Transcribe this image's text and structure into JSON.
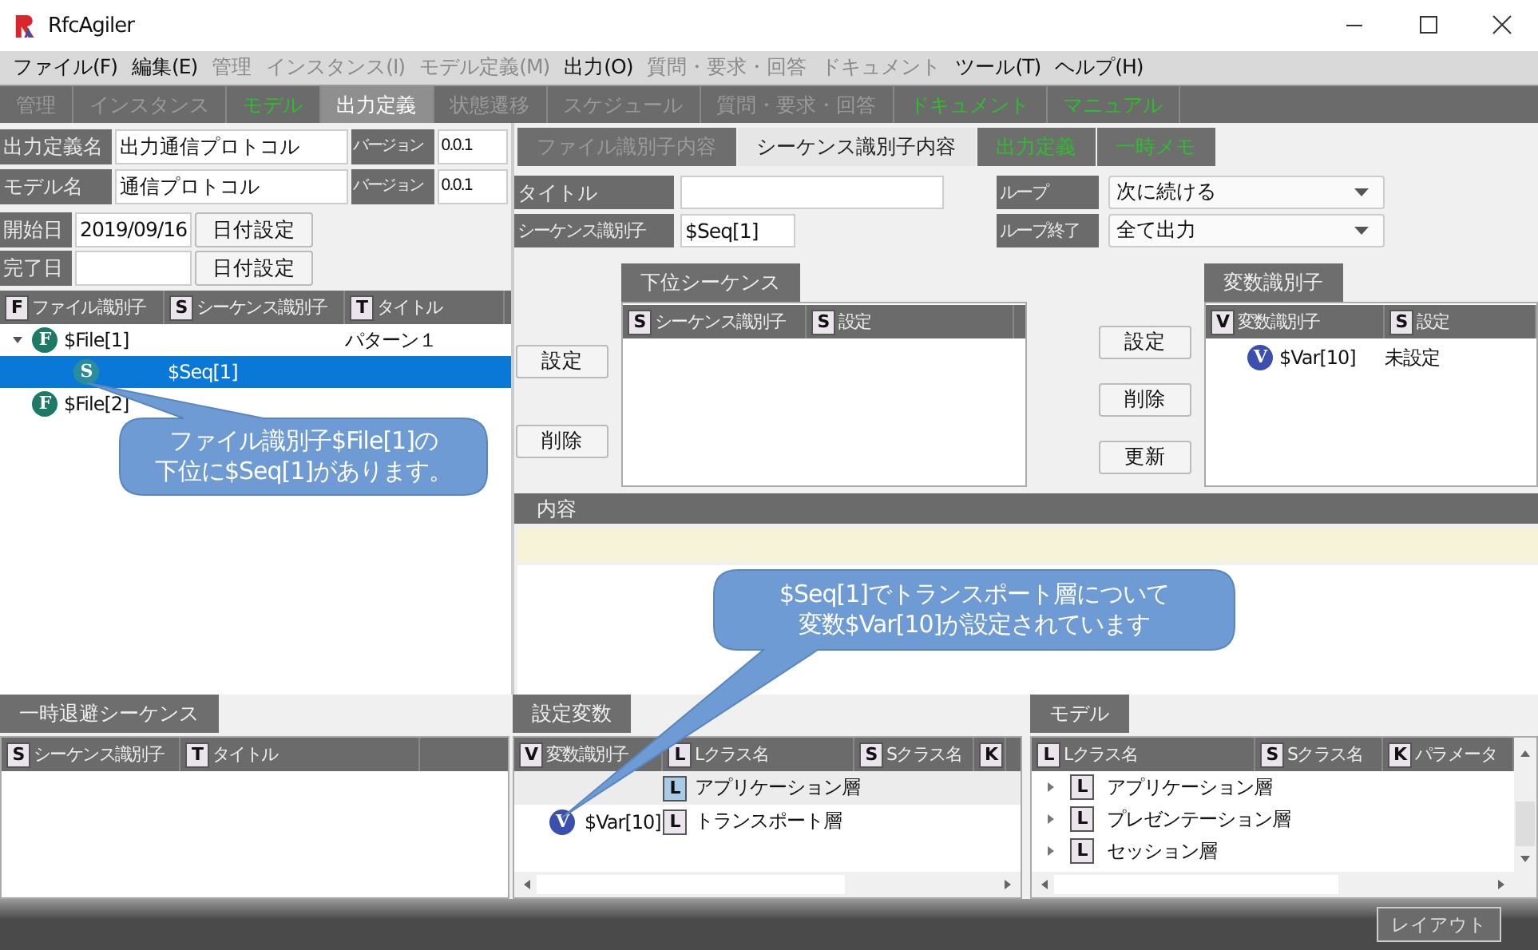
{
  "window": {
    "title": "RfcAgiler"
  },
  "menu": [
    {
      "label": "ファイル(F)",
      "disabled": false
    },
    {
      "label": "編集(E)",
      "disabled": false
    },
    {
      "label": "管理",
      "disabled": true
    },
    {
      "label": "インスタンス(I)",
      "disabled": true
    },
    {
      "label": "モデル定義(M)",
      "disabled": true
    },
    {
      "label": "出力(O)",
      "disabled": false
    },
    {
      "label": "質問・要求・回答",
      "disabled": true
    },
    {
      "label": "ドキュメント",
      "disabled": true
    },
    {
      "label": "ツール(T)",
      "disabled": false
    },
    {
      "label": "ヘルプ(H)",
      "disabled": false
    }
  ],
  "main_tabs": [
    {
      "label": "管理",
      "kind": "dimmed",
      "selected": false
    },
    {
      "label": "インスタンス",
      "kind": "dimmed",
      "selected": false
    },
    {
      "label": "モデル",
      "kind": "green",
      "selected": false
    },
    {
      "label": "出力定義",
      "kind": "plain",
      "selected": true
    },
    {
      "label": "状態遷移",
      "kind": "dimmed",
      "selected": false
    },
    {
      "label": "スケジュール",
      "kind": "dimmed",
      "selected": false
    },
    {
      "label": "質問・要求・回答",
      "kind": "dimmed",
      "selected": false
    },
    {
      "label": "ドキュメント",
      "kind": "green",
      "selected": false
    },
    {
      "label": "マニュアル",
      "kind": "green",
      "selected": false
    }
  ],
  "definition": [
    {
      "label": "出力定義名",
      "value": "出力通信プロトコル",
      "version_label": "バージョン",
      "version": "0.0.1"
    },
    {
      "label": "モデル名",
      "value": "通信プロトコル",
      "version_label": "バージョン",
      "version": "0.0.1"
    }
  ],
  "dates": [
    {
      "label": "開始日",
      "value": "2019/09/16",
      "button": "日付設定"
    },
    {
      "label": "完了日",
      "button": "日付設定"
    }
  ],
  "tree": {
    "columns": [
      {
        "badge": "F",
        "label": "ファイル識別子"
      },
      {
        "badge": "S",
        "label": "シーケンス識別子"
      },
      {
        "badge": "T",
        "label": "タイトル"
      }
    ],
    "rows": [
      {
        "badge": "F",
        "color": "#1e7a66",
        "identifier": "$File[1]",
        "title": "パターン１",
        "expanded": true,
        "selected": false,
        "children": [
          {
            "badge": "S",
            "color": "#2b8c9c",
            "identifier": "$Seq[1]",
            "selected": true
          }
        ]
      },
      {
        "badge": "F",
        "color": "#1e7a66",
        "identifier": "$File[2]",
        "selected": false
      }
    ]
  },
  "sub_tabs": [
    {
      "label": "ファイル識別子内容",
      "kind": "dimmed",
      "selected": false
    },
    {
      "label": "シーケンス識別子内容",
      "kind": "plain",
      "selected": true
    },
    {
      "label": "出力定義",
      "kind": "green",
      "selected": false
    },
    {
      "label": "一時メモ",
      "kind": "green",
      "selected": false
    }
  ],
  "form": {
    "title": {
      "label": "タイトル"
    },
    "sequence_id": {
      "label": "シーケンス識別子",
      "value": "$Seq[1]"
    },
    "loop": {
      "label": "ループ",
      "value": "次に続ける"
    },
    "loop_end": {
      "label": "ループ終了",
      "value": "全て出力"
    }
  },
  "side_buttons": [
    "設定",
    "削除"
  ],
  "sub_sequence": {
    "tab": "下位シーケンス",
    "columns": [
      {
        "badge": "S",
        "label": "シーケンス識別子"
      },
      {
        "badge": "S",
        "label": "設定"
      }
    ]
  },
  "middle_buttons": [
    "設定",
    "削除",
    "更新"
  ],
  "variables": {
    "tab": "変数識別子",
    "columns": [
      {
        "badge": "V",
        "label": "変数識別子"
      },
      {
        "badge": "S",
        "label": "設定"
      }
    ],
    "rows": [
      {
        "badge": "V",
        "color": "#3b4fae",
        "identifier": "$Var[10]",
        "setting": "未設定"
      }
    ]
  },
  "content": {
    "label": "内容"
  },
  "callouts": [
    {
      "lines": [
        "ファイル識別子$File[1]の",
        "下位に$Seq[1]があります。"
      ]
    },
    {
      "lines": [
        "$Seq[1]でトランスポート層について",
        "変数$Var[10]が設定されています"
      ]
    }
  ],
  "temp_sequence": {
    "tab": "一時退避シーケンス",
    "columns": [
      {
        "badge": "S",
        "label": "シーケンス識別子"
      },
      {
        "badge": "T",
        "label": "タイトル"
      }
    ]
  },
  "set_variables": {
    "tab": "設定変数",
    "columns": [
      {
        "badge": "V",
        "label": "変数識別子"
      },
      {
        "badge": "L",
        "label": "Lクラス名"
      },
      {
        "badge": "S",
        "label": "Sクラス名"
      },
      {
        "badge": "K"
      }
    ],
    "rows": [
      {
        "highlighted": true,
        "class_badge": "L",
        "class_name": "アプリケーション層"
      },
      {
        "highlighted": false,
        "badge": "V",
        "color": "#3b4fae",
        "identifier": "$Var[10]",
        "class_badge": "L",
        "class_name": "トランスポート層"
      }
    ]
  },
  "model": {
    "tab": "モデル",
    "columns": [
      {
        "badge": "L",
        "label": "Lクラス名"
      },
      {
        "badge": "S",
        "label": "Sクラス名"
      },
      {
        "badge": "K",
        "label": "パラメータ"
      }
    ],
    "rows": [
      {
        "badge": "L",
        "name": "アプリケーション層",
        "expanded": false
      },
      {
        "badge": "L",
        "name": "プレゼンテーション層",
        "expanded": false
      },
      {
        "badge": "L",
        "name": "セッション層",
        "expanded": false
      }
    ]
  },
  "status_bar": {
    "button": "レイアウト"
  }
}
